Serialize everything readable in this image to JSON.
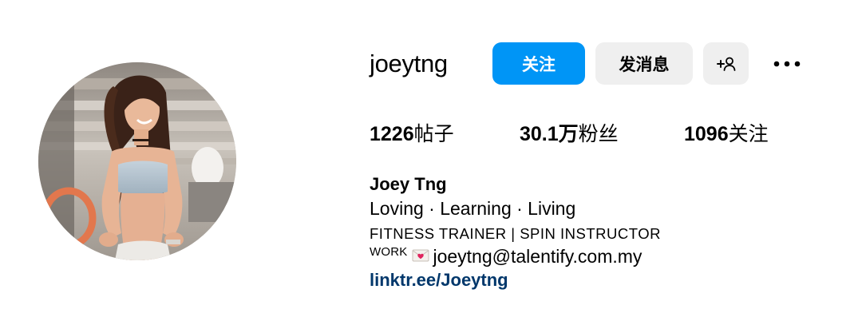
{
  "profile": {
    "username": "joeytng",
    "full_name": "Joey Tng",
    "bio_line1": "Loving · Learning · Living",
    "bio_line2": "FITNESS TRAINER | SPIN INSTRUCTOR",
    "work_tag": "WORK",
    "email": "joeytng@talentify.com.my",
    "link": "linktr.ee/Joeytng"
  },
  "actions": {
    "follow_label": "关注",
    "message_label": "发消息",
    "suggest_icon": "add-person-icon",
    "more_icon": "more-horizontal-icon"
  },
  "stats": {
    "posts_count": "1226",
    "posts_label": "帖子",
    "followers_count": "30.1万",
    "followers_label": "粉丝",
    "following_count": "1096",
    "following_label": "关注"
  },
  "colors": {
    "primary_button": "#0095f6",
    "secondary_button": "#efefef",
    "link": "#00376b"
  }
}
